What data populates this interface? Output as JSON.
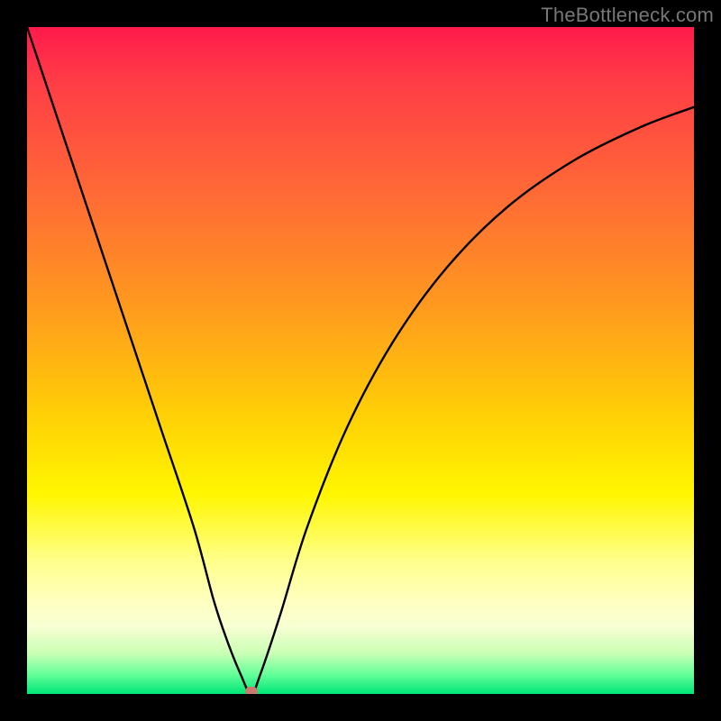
{
  "watermark": "TheBottleneck.com",
  "chart_data": {
    "type": "line",
    "title": "",
    "xlabel": "",
    "ylabel": "",
    "x_range": [
      0,
      100
    ],
    "y_range": [
      0,
      100
    ],
    "series": [
      {
        "name": "bottleneck-curve",
        "x": [
          0,
          5,
          10,
          15,
          20,
          25,
          28,
          30,
          32,
          33.6,
          35,
          38,
          42,
          48,
          55,
          63,
          72,
          82,
          92,
          100
        ],
        "y": [
          100,
          85,
          70,
          55,
          40,
          25,
          14,
          8,
          3,
          0,
          3,
          12,
          25,
          40,
          53,
          64,
          73,
          80,
          85,
          88
        ]
      }
    ],
    "marker": {
      "x": 33.6,
      "y": 0
    },
    "gradient_note": "background gradient encodes bottleneck severity: green ~0%, yellow mid, red high"
  }
}
